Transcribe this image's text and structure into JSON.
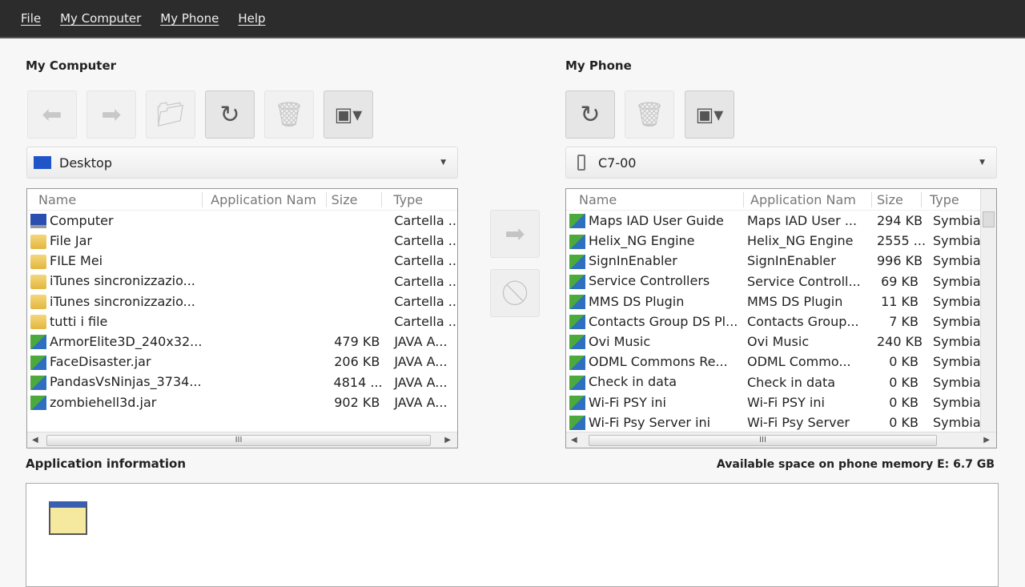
{
  "menu": [
    "File",
    "My Computer",
    "My Phone",
    "Help"
  ],
  "left": {
    "title": "My Computer",
    "location": "Desktop",
    "columns": [
      "Name",
      "Application Nam",
      "Size",
      "Type"
    ],
    "rows": [
      {
        "icon": "computer",
        "name": "Computer",
        "app": "",
        "size": "",
        "type": "Cartella ..."
      },
      {
        "icon": "folder",
        "name": "File Jar",
        "app": "",
        "size": "",
        "type": "Cartella ..."
      },
      {
        "icon": "folder",
        "name": "FILE Mei",
        "app": "",
        "size": "",
        "type": "Cartella ..."
      },
      {
        "icon": "folder",
        "name": "iTunes sincronizzazio...",
        "app": "",
        "size": "",
        "type": "Cartella ..."
      },
      {
        "icon": "folder",
        "name": "iTunes sincronizzazio...",
        "app": "",
        "size": "",
        "type": "Cartella ..."
      },
      {
        "icon": "folder",
        "name": "tutti i file",
        "app": "",
        "size": "",
        "type": "Cartella ..."
      },
      {
        "icon": "app",
        "name": "ArmorElite3D_240x32...",
        "app": "",
        "size": "479 KB",
        "type": "JAVA A..."
      },
      {
        "icon": "app",
        "name": "FaceDisaster.jar",
        "app": "",
        "size": "206 KB",
        "type": "JAVA A..."
      },
      {
        "icon": "app",
        "name": "PandasVsNinjas_3734...",
        "app": "",
        "size": "4814 ...",
        "type": "JAVA A..."
      },
      {
        "icon": "app",
        "name": "zombiehell3d.jar",
        "app": "",
        "size": "902 KB",
        "type": "JAVA A..."
      }
    ]
  },
  "right": {
    "title": "My Phone",
    "location": "C7-00",
    "columns": [
      "Name",
      "Application Nam",
      "Size",
      "Type"
    ],
    "rows": [
      {
        "name": "Maps IAD User Guide",
        "app": "Maps IAD User ...",
        "size": "294 KB",
        "type": "Symbia"
      },
      {
        "name": "Helix_NG Engine",
        "app": "Helix_NG Engine",
        "size": "2555 ...",
        "type": "Symbia"
      },
      {
        "name": "SignInEnabler",
        "app": "SignInEnabler",
        "size": "996 KB",
        "type": "Symbia"
      },
      {
        "name": "Service Controllers",
        "app": "Service Controll...",
        "size": "69 KB",
        "type": "Symbia"
      },
      {
        "name": "MMS DS Plugin",
        "app": "MMS DS Plugin",
        "size": "11 KB",
        "type": "Symbia"
      },
      {
        "name": "Contacts Group DS Pl...",
        "app": "Contacts Group...",
        "size": "7 KB",
        "type": "Symbia"
      },
      {
        "name": "Ovi Music",
        "app": "Ovi Music",
        "size": "240 KB",
        "type": "Symbia"
      },
      {
        "name": "ODML Commons Re...",
        "app": "ODML Commo...",
        "size": "0 KB",
        "type": "Symbia"
      },
      {
        "name": "Check in data",
        "app": "Check in data",
        "size": "0 KB",
        "type": "Symbia"
      },
      {
        "name": "Wi-Fi PSY ini",
        "app": "Wi-Fi PSY ini",
        "size": "0 KB",
        "type": "Symbia"
      },
      {
        "name": "Wi-Fi Psy Server ini",
        "app": "Wi-Fi Psy Server",
        "size": "0 KB",
        "type": "Symbia"
      }
    ]
  },
  "app_info_label": "Application information",
  "available_space": "Available space on phone memory E: 6.7 GB",
  "scroll_grip": "III"
}
